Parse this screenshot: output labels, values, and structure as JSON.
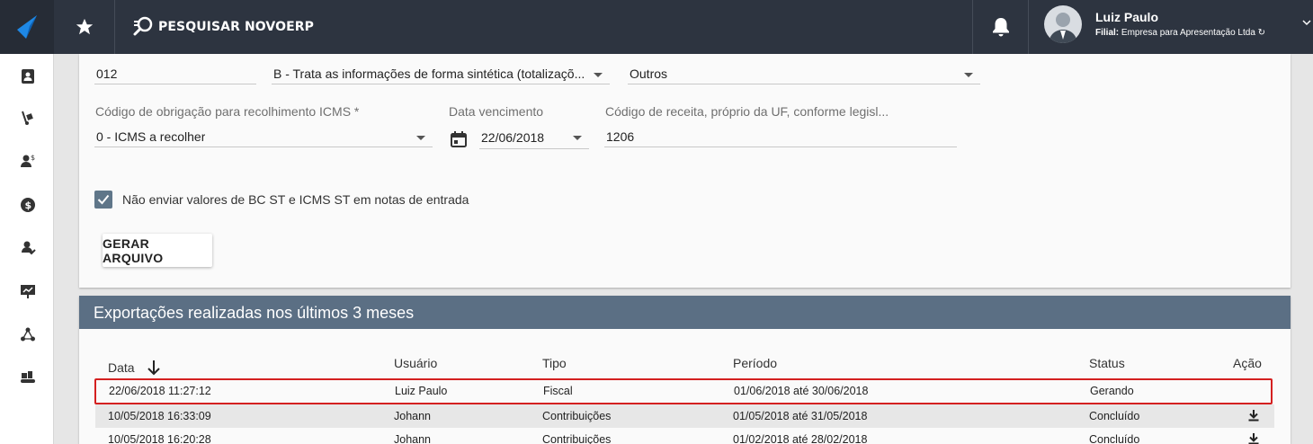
{
  "topbar": {
    "search_label": "PESQUISAR NOVOERP",
    "user_name": "Luiz Paulo",
    "branch_label": "Filial:",
    "branch_value": "Empresa para Apresentação Ltda"
  },
  "form": {
    "field1_value": "012",
    "field2_value": "B - Trata as informações de forma sintética (totalizaçõ...",
    "field3_value": "Outros",
    "obligation_label": "Código de obrigação para recolhimento ICMS *",
    "obligation_value": "0 - ICMS a recolher",
    "due_date_label": "Data vencimento",
    "due_date_value": "22/06/2018",
    "revenue_label": "Código de receita, próprio da UF, conforme legisl...",
    "revenue_value": "1206",
    "checkbox_label": "Não enviar valores de BC ST e ICMS ST em notas de entrada",
    "generate_button": "GERAR ARQUIVO"
  },
  "exports": {
    "title": "Exportações realizadas nos últimos 3 meses",
    "columns": [
      "Data",
      "Usuário",
      "Tipo",
      "Período",
      "Status",
      "Ação"
    ],
    "rows": [
      {
        "date": "22/06/2018 11:27:12",
        "user": "Luiz Paulo",
        "type": "Fiscal",
        "period": "01/06/2018 até 30/06/2018",
        "status": "Gerando"
      },
      {
        "date": "10/05/2018 16:33:09",
        "user": "Johann",
        "type": "Contribuições",
        "period": "01/05/2018 até 31/05/2018",
        "status": "Concluído"
      },
      {
        "date": "10/05/2018 16:20:28",
        "user": "Johann",
        "type": "Contribuições",
        "period": "01/02/2018 até 28/02/2018",
        "status": "Concluído"
      }
    ]
  },
  "colors": {
    "topbar": "#2d3440",
    "section_header": "#5b6f84",
    "logo_accent": "#1e88e5",
    "selected_row_border": "#d42020"
  }
}
